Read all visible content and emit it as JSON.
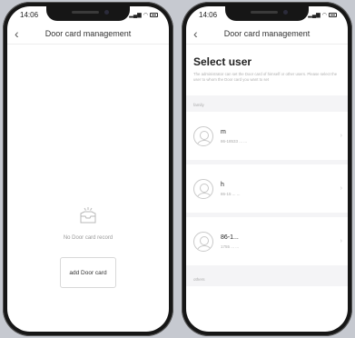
{
  "left_phone": {
    "status_time": "14:06",
    "nav_title": "Door card management",
    "empty_text": "No Door card record",
    "add_button": "add Door card"
  },
  "right_phone": {
    "status_time": "14:06",
    "nav_title": "Door card management",
    "select_title": "Select user",
    "select_desc": "The administrator can set the Door card of himself or other users. Please select the user to whom the Door card you want to set",
    "section_family": "family",
    "section_others": "others",
    "users": [
      {
        "name": "m",
        "sub": "86-18533 ... ..."
      },
      {
        "name": "h",
        "sub": "86-15 ... ..."
      },
      {
        "name": "86-1...",
        "sub": "1755 ... ..."
      }
    ]
  }
}
